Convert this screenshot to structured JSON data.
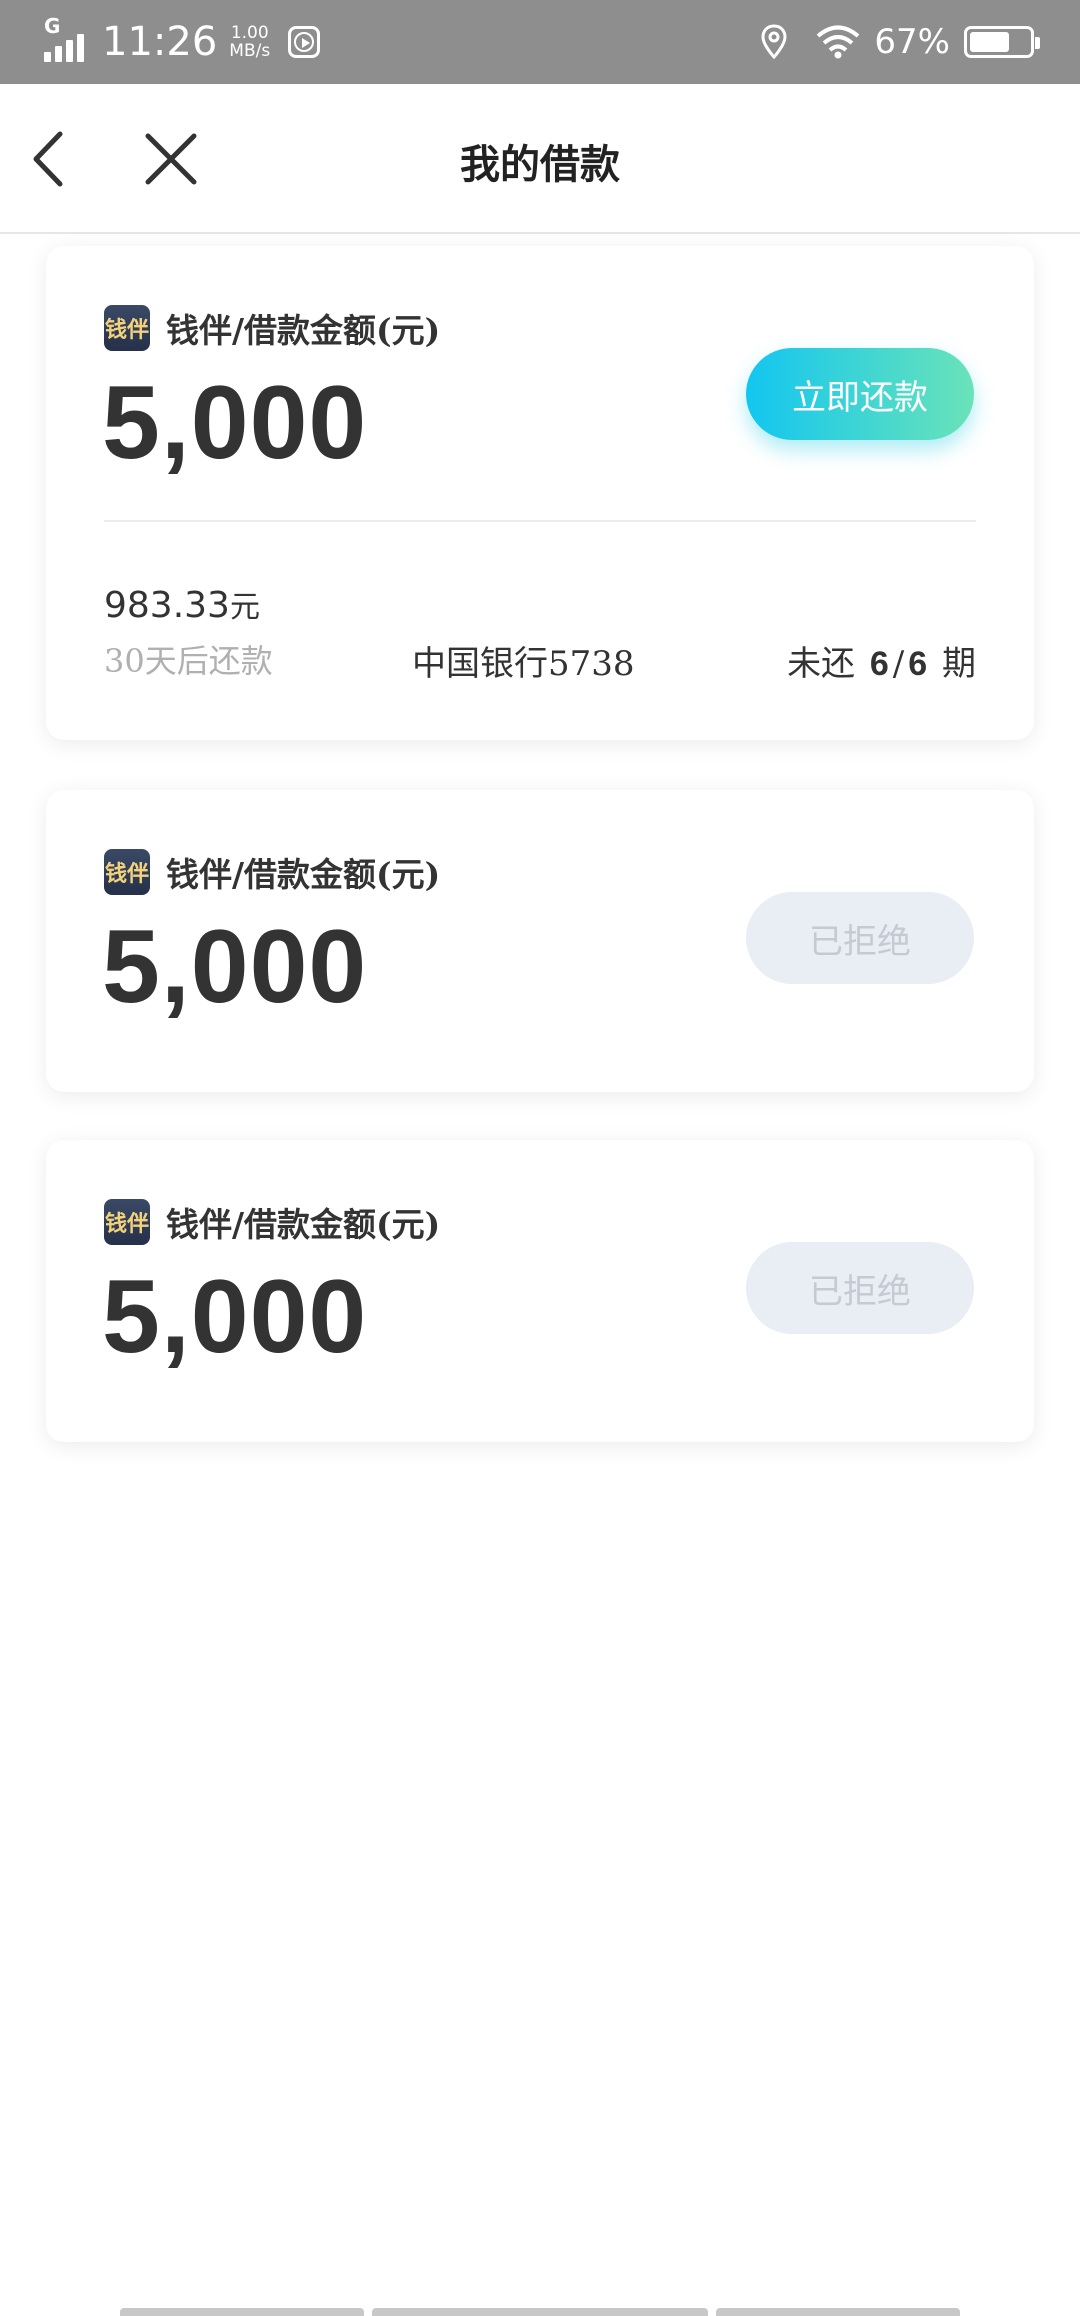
{
  "status_bar": {
    "network_type": "G",
    "time": "11:26",
    "speed_value": "1.00",
    "speed_unit": "MB/s",
    "battery_percent": "67%",
    "battery_level": 0.67,
    "icons": [
      "signal-icon",
      "media-play-icon",
      "location-icon",
      "wifi-icon",
      "battery-icon"
    ]
  },
  "nav": {
    "title": "我的借款",
    "icons": [
      "back-arrow-icon",
      "close-icon"
    ]
  },
  "loans": [
    {
      "logo_text": "钱伴",
      "label": "钱伴/借款金额(元)",
      "amount": "5,000",
      "action_label": "立即还款",
      "detail": {
        "installment_amount": "983.33",
        "installment_unit": "元",
        "due_text": "30天后还款",
        "bank": "中国银行5738",
        "term_prefix": "未还",
        "term_remaining": "6",
        "term_total": "6",
        "term_suffix": "期"
      }
    },
    {
      "logo_text": "钱伴",
      "label": "钱伴/借款金额(元)",
      "amount": "5,000",
      "status_label": "已拒绝"
    },
    {
      "logo_text": "钱伴",
      "label": "钱伴/借款金额(元)",
      "amount": "5,000",
      "status_label": "已拒绝"
    }
  ],
  "colors": {
    "status_bar_bg": "#8e8e8e",
    "repay_gradient_start": "#12c6f0",
    "repay_gradient_end": "#6ae3b8",
    "rejected_bg": "#e9eef4",
    "rejected_text": "#c4c9d3"
  }
}
